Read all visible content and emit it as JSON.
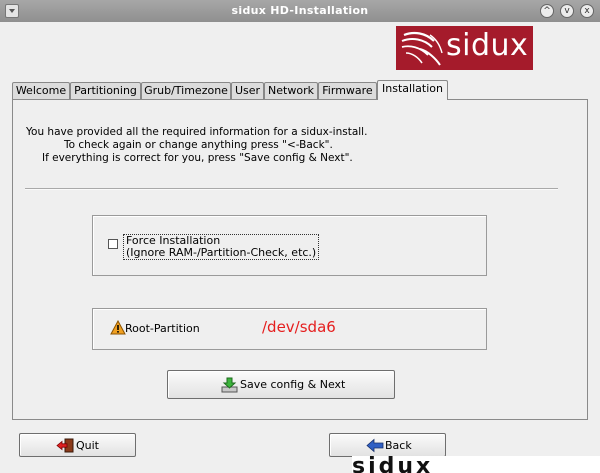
{
  "window": {
    "title": "sidux HD-Installation",
    "buttons": [
      "^",
      "v",
      "x"
    ]
  },
  "logo": {
    "text": "sidux",
    "color": "#a51b2b"
  },
  "tabs": [
    {
      "label": "Welcome"
    },
    {
      "label": "Partitioning"
    },
    {
      "label": "Grub/Timezone"
    },
    {
      "label": "User"
    },
    {
      "label": "Network"
    },
    {
      "label": "Firmware"
    },
    {
      "label": "Installation",
      "active": true
    }
  ],
  "info": {
    "line1": "You have provided all the required information for a sidux-install.",
    "line2": "To check again or change anything press \"<-Back\".",
    "line3": "If everything is correct for you, press \"Save config & Next\"."
  },
  "force": {
    "label_line1": "Force Installation",
    "label_line2": "(Ignore RAM-/Partition-Check, etc.)",
    "checked": false
  },
  "root": {
    "label": "Root-Partition",
    "value": "/dev/sda6",
    "value_color": "#e51e1e",
    "icon": "warning-icon"
  },
  "buttons": {
    "save": {
      "label": "Save config & Next",
      "icon": "save-download-icon"
    },
    "quit": {
      "label": "Quit",
      "icon": "exit-door-icon"
    },
    "back": {
      "label": "Back",
      "icon": "arrow-left-icon"
    }
  },
  "background": {
    "text": "sidux"
  }
}
